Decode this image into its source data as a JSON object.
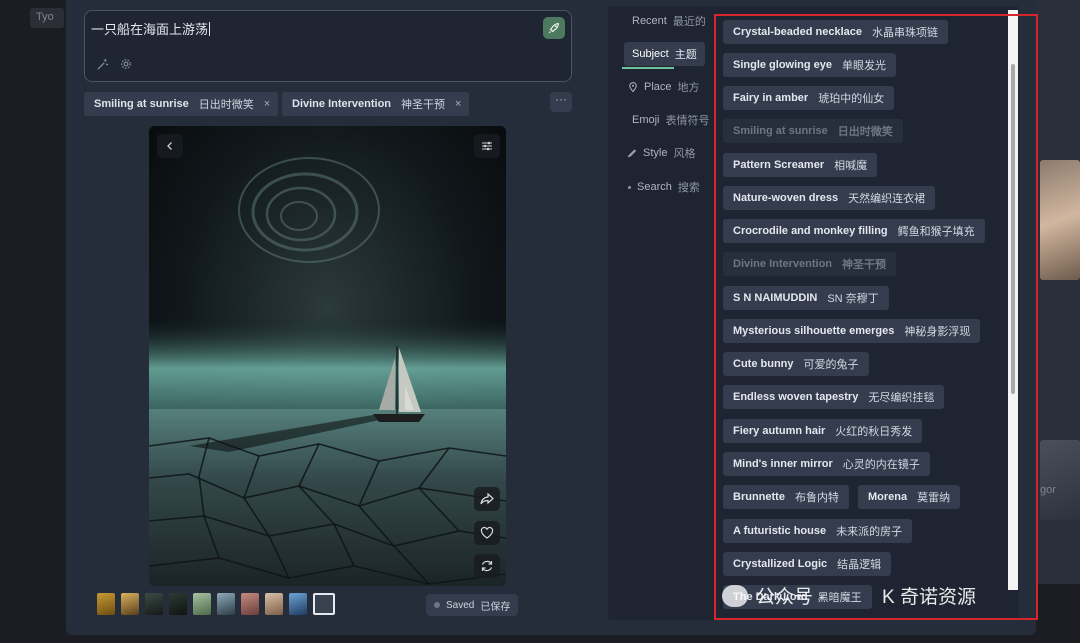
{
  "background": {
    "left_chip": "Tyo",
    "right_text": "gor"
  },
  "prompt": {
    "text": "一只船在海面上游荡"
  },
  "tags": [
    {
      "en": "Smiling at sunrise",
      "zh": "日出时微笑",
      "remove": "×"
    },
    {
      "en": "Divine Intervention",
      "zh": "神圣干预",
      "remove": "×"
    }
  ],
  "more_label": "···",
  "image": {
    "description": "sailboat on cracked frozen sea under swirling night sky"
  },
  "status": {
    "saved_en": "Saved",
    "saved_zh": "已保存"
  },
  "categories": [
    {
      "en": "Recent",
      "zh": "最近的",
      "icon": "",
      "active": false
    },
    {
      "en": "Subject",
      "zh": "主题",
      "icon": "",
      "active": true
    },
    {
      "en": "Place",
      "zh": "地方",
      "icon": "pin-icon",
      "active": false
    },
    {
      "en": "Emoji",
      "zh": "表情符号",
      "icon": "",
      "active": false
    },
    {
      "en": "Style",
      "zh": "风格",
      "icon": "brush-icon",
      "active": false
    },
    {
      "en": "Search",
      "zh": "搜索",
      "icon": "dot-icon",
      "active": false
    }
  ],
  "subject_items": [
    {
      "en": "Crystal-beaded necklace",
      "zh": "水晶串珠项链",
      "disabled": false
    },
    {
      "en": "Single glowing eye",
      "zh": "单眼发光",
      "disabled": false
    },
    {
      "en": "Fairy in amber",
      "zh": "琥珀中的仙女",
      "disabled": false
    },
    {
      "en": "Smiling at sunrise",
      "zh": "日出时微笑",
      "disabled": true
    },
    {
      "en": "Pattern Screamer",
      "zh": "相喊魔",
      "disabled": false
    },
    {
      "en": "Nature-woven dress",
      "zh": "天然编织连衣裙",
      "disabled": false
    },
    {
      "en": "Crocrodile and monkey filling",
      "zh": "鳄鱼和猴子填充",
      "disabled": false
    },
    {
      "en": "Divine Intervention",
      "zh": "神圣干预",
      "disabled": true
    },
    {
      "en": "S N NAIMUDDIN",
      "zh": "SN 奈穆丁",
      "disabled": false
    },
    {
      "en": "Mysterious silhouette emerges",
      "zh": "神秘身影浮现",
      "disabled": false
    },
    {
      "en": "Cute bunny",
      "zh": "可爱的兔子",
      "disabled": false
    },
    {
      "en": "Endless woven tapestry",
      "zh": "无尽编织挂毯",
      "disabled": false
    },
    {
      "en": "Fiery autumn hair",
      "zh": "火红的秋日秀发",
      "disabled": false
    },
    {
      "en": "Mind's inner mirror",
      "zh": "心灵的内在镜子",
      "disabled": false
    },
    {
      "en": "Brunnette",
      "zh": "布鲁内特",
      "disabled": false
    },
    {
      "en": "Morena",
      "zh": "莫雷纳",
      "disabled": false
    },
    {
      "en": "A futuristic house",
      "zh": "未来派的房子",
      "disabled": false
    },
    {
      "en": "Crystallized Logic",
      "zh": "结晶逻辑",
      "disabled": false
    },
    {
      "en": "The Dark Lord",
      "zh": "黑暗魔王",
      "disabled": false
    }
  ],
  "watermark": {
    "left": "公众号 ·",
    "right": "K 奇诺资源"
  },
  "colors": {
    "accent_green": "#6ec49a",
    "highlight_red": "#d4262c",
    "go_button": "#4d7a5e"
  }
}
